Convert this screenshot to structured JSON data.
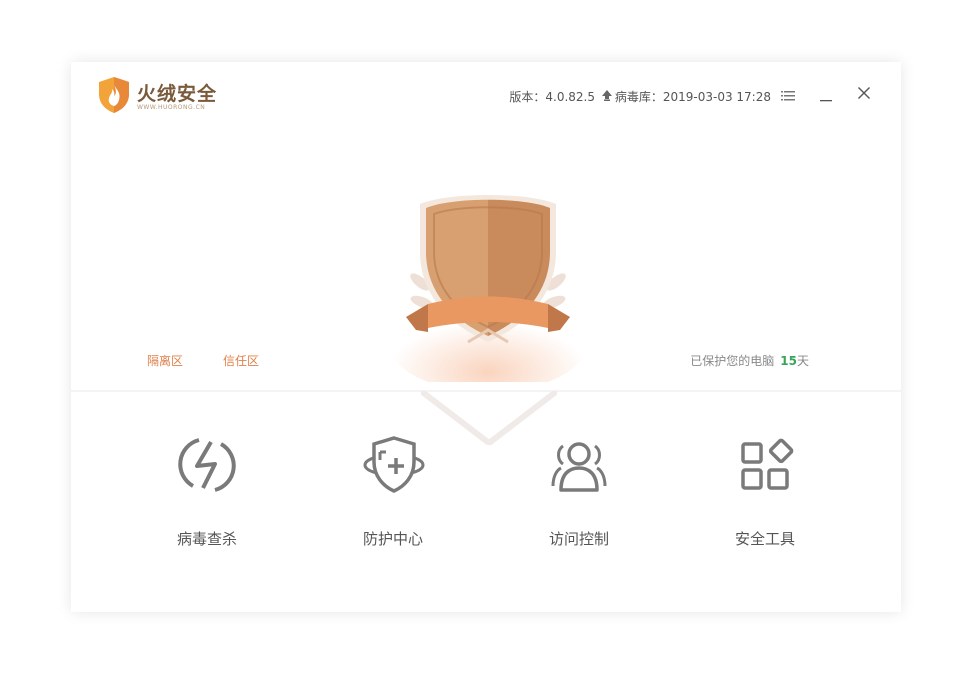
{
  "app": {
    "title": "火绒安全",
    "url": "WWW.HUORONG.CN"
  },
  "topbar": {
    "version_label": "版本：4.0.82.5",
    "virus_db_label": "病毒库：2019-03-03 17:28"
  },
  "hero": {
    "quarantine_label": "隔离区",
    "trust_label": "信任区",
    "protected_prefix": "已保护您的电脑",
    "protected_days": "15",
    "protected_unit": "天"
  },
  "features": [
    {
      "label": "病毒查杀",
      "icon": "lightning-circle-icon"
    },
    {
      "label": "防护中心",
      "icon": "shield-orbit-icon"
    },
    {
      "label": "访问控制",
      "icon": "users-icon"
    },
    {
      "label": "安全工具",
      "icon": "tools-grid-icon"
    }
  ],
  "colors": {
    "accent": "#e0804a",
    "days": "#3aa35b",
    "icon_gray": "#7a7a7a",
    "shield_tan": "#d39a6a"
  }
}
